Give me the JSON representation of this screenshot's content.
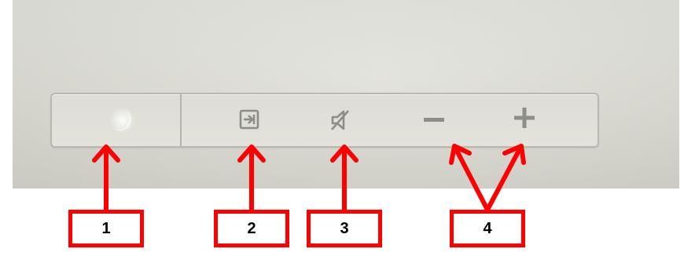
{
  "panel": {
    "buttons": [
      {
        "id": "sleep",
        "icon": "moon-icon"
      },
      {
        "id": "input",
        "icon": "input-source-icon"
      },
      {
        "id": "mute",
        "icon": "speaker-mute-icon"
      },
      {
        "id": "volume_down",
        "icon": "minus-icon"
      },
      {
        "id": "volume_up",
        "icon": "plus-icon"
      }
    ]
  },
  "callouts": {
    "labels": [
      "1",
      "2",
      "3",
      "4"
    ]
  },
  "colors": {
    "panel_surface": "#dcdcd4",
    "icon_gray": "#8e8e88",
    "moon_glow": "#fbfbf6",
    "annotation_red": "#ff0000"
  }
}
